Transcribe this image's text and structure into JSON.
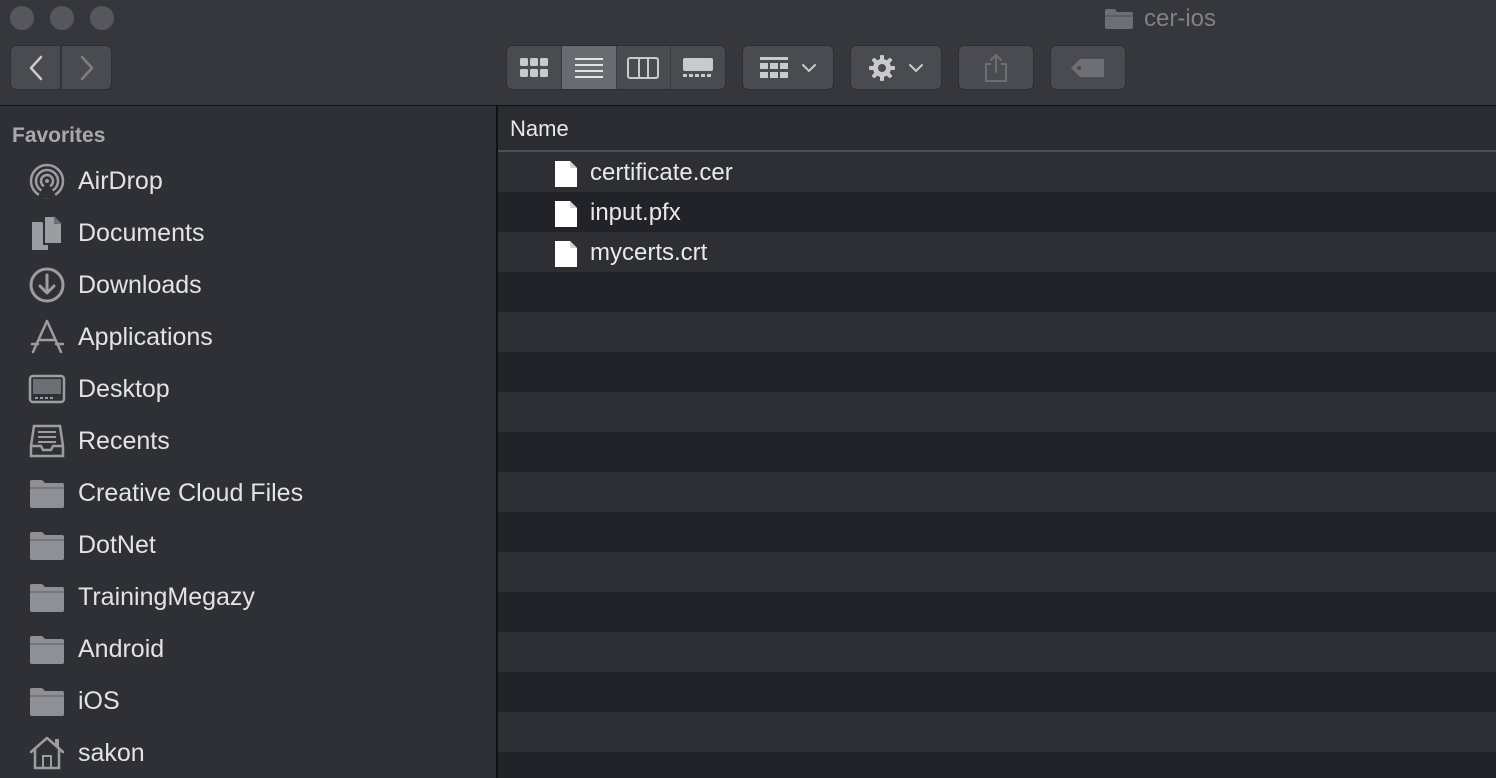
{
  "window": {
    "title": "cer-ios"
  },
  "sidebar": {
    "heading": "Favorites",
    "items": [
      {
        "label": "AirDrop",
        "icon": "airdrop-icon"
      },
      {
        "label": "Documents",
        "icon": "documents-icon"
      },
      {
        "label": "Downloads",
        "icon": "downloads-icon"
      },
      {
        "label": "Applications",
        "icon": "applications-icon"
      },
      {
        "label": "Desktop",
        "icon": "desktop-icon"
      },
      {
        "label": "Recents",
        "icon": "recents-icon"
      },
      {
        "label": "Creative Cloud Files",
        "icon": "folder-icon"
      },
      {
        "label": "DotNet",
        "icon": "folder-icon"
      },
      {
        "label": "TrainingMegazy",
        "icon": "folder-icon"
      },
      {
        "label": "Android",
        "icon": "folder-icon"
      },
      {
        "label": "iOS",
        "icon": "folder-icon"
      },
      {
        "label": "sakon",
        "icon": "home-icon"
      }
    ]
  },
  "file_list": {
    "column_name": "Name",
    "files": [
      {
        "name": "certificate.cer",
        "icon": "document-file-icon"
      },
      {
        "name": "input.pfx",
        "icon": "document-file-icon"
      },
      {
        "name": "mycerts.crt",
        "icon": "document-file-icon"
      }
    ]
  },
  "toolbar": {
    "view_modes": [
      "icon-view",
      "list-view",
      "column-view",
      "gallery-view"
    ],
    "active_view": "list-view"
  },
  "colors": {
    "toolbar_bg": "#36373c",
    "sidebar_bg": "#2f3035",
    "content_bg": "#222328",
    "row_alt_bg": "#2e2f34",
    "text_primary": "#e2e3e7",
    "text_secondary": "#a8a9ae"
  }
}
